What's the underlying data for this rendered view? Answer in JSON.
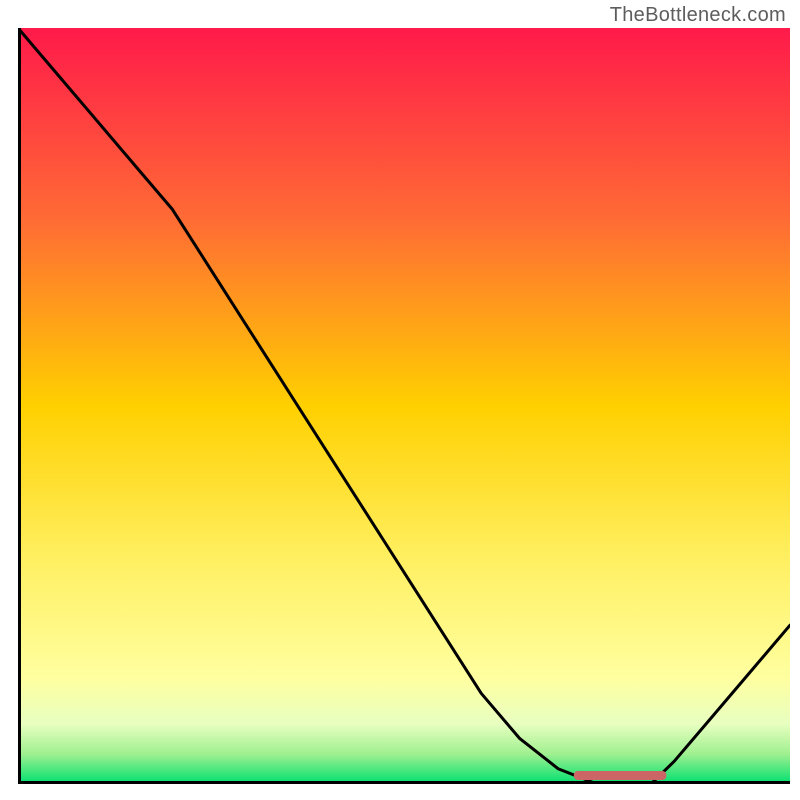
{
  "watermark": "TheBottleneck.com",
  "chart_data": {
    "type": "line",
    "title": "",
    "xlabel": "",
    "ylabel": "",
    "xlim": [
      0,
      100
    ],
    "ylim": [
      0,
      100
    ],
    "gradient_stops": [
      {
        "offset": 0.0,
        "color": "#ff1a4a"
      },
      {
        "offset": 0.25,
        "color": "#ff6a35"
      },
      {
        "offset": 0.5,
        "color": "#ffd000"
      },
      {
        "offset": 0.7,
        "color": "#ffef60"
      },
      {
        "offset": 0.86,
        "color": "#ffffa0"
      },
      {
        "offset": 0.92,
        "color": "#e8ffc0"
      },
      {
        "offset": 0.96,
        "color": "#a0f090"
      },
      {
        "offset": 1.0,
        "color": "#00e070"
      }
    ],
    "curve": {
      "x": [
        0,
        5,
        10,
        15,
        20,
        25,
        30,
        35,
        40,
        45,
        50,
        55,
        60,
        65,
        70,
        75,
        80,
        82,
        85,
        90,
        95,
        100
      ],
      "values": [
        100,
        94,
        88,
        82,
        76,
        68,
        60,
        52,
        44,
        36,
        28,
        20,
        12,
        6,
        2,
        0,
        0,
        0,
        3,
        9,
        15,
        21
      ]
    },
    "highlight_segment": {
      "x_start": 72,
      "x_end": 84,
      "y": 0.8,
      "color": "#cc6666"
    }
  }
}
